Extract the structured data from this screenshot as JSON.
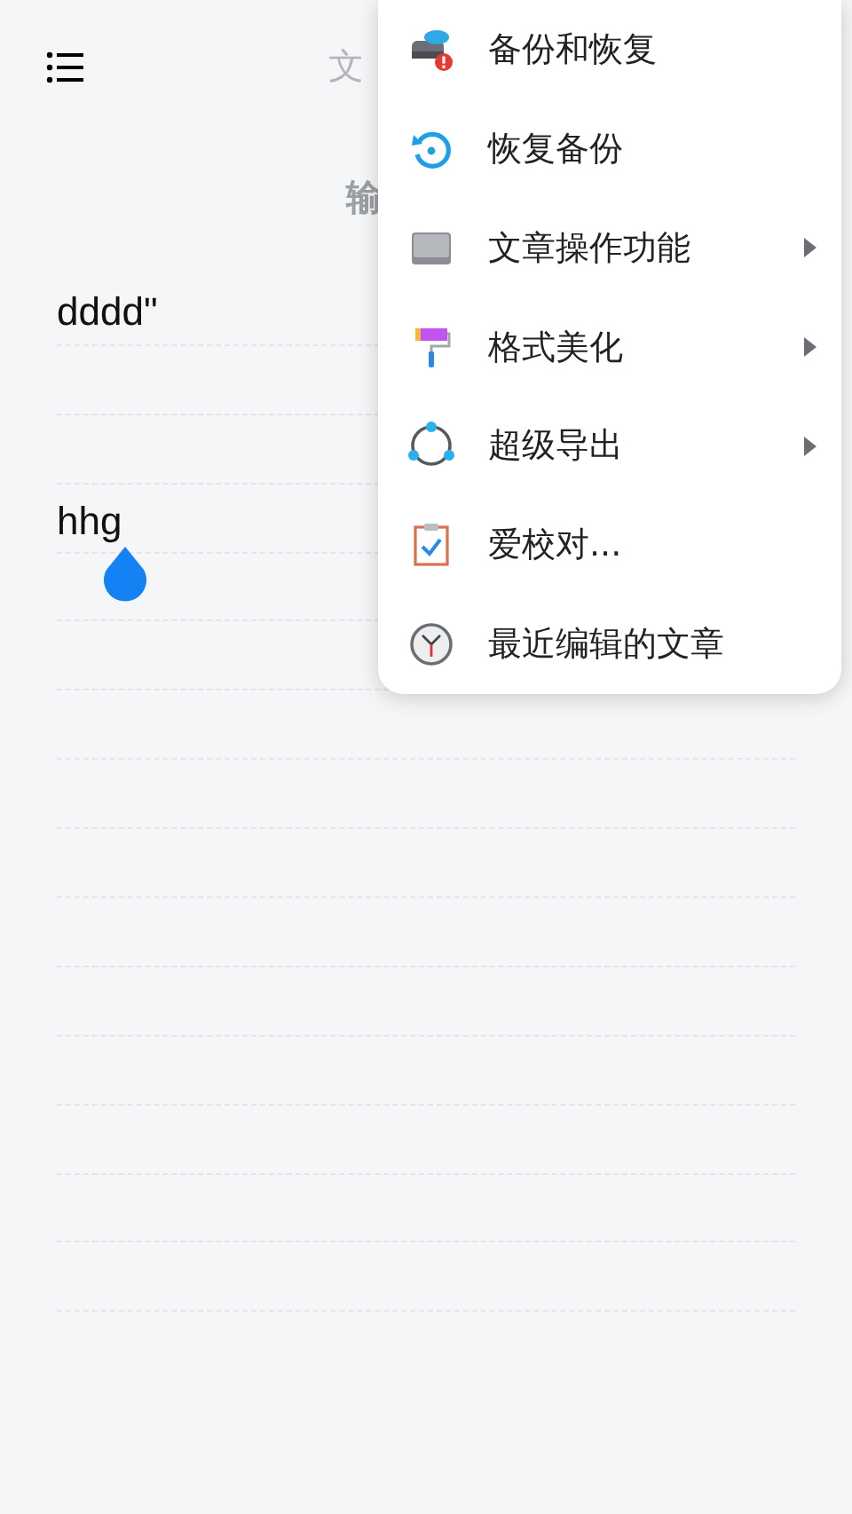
{
  "header": {
    "title": "文",
    "subtitle": "输"
  },
  "editor": {
    "text": "dddd\"\n\n\nhhg",
    "cursor_handle": true
  },
  "menu": {
    "items": [
      {
        "label": "备份和恢复",
        "has_submenu": false
      },
      {
        "label": "恢复备份",
        "has_submenu": false
      },
      {
        "label": "文章操作功能",
        "has_submenu": true
      },
      {
        "label": "格式美化",
        "has_submenu": true
      },
      {
        "label": "超级导出",
        "has_submenu": true
      },
      {
        "label": "爱校对...",
        "has_submenu": false
      },
      {
        "label": "最近编辑的文章",
        "has_submenu": false
      }
    ]
  }
}
